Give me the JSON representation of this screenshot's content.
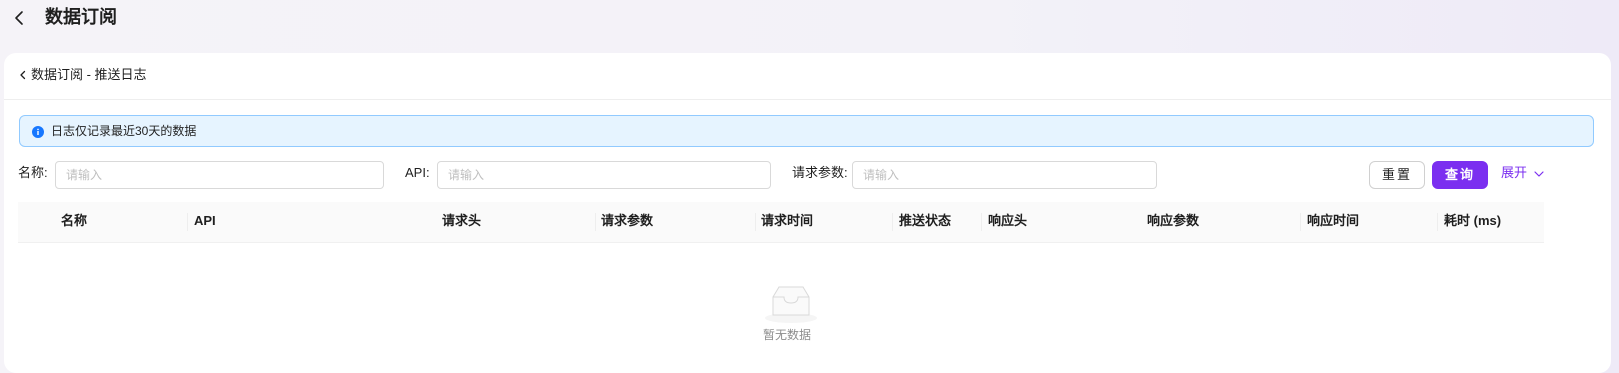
{
  "page": {
    "title": "数据订阅"
  },
  "breadcrumb": {
    "label": "数据订阅 - 推送日志"
  },
  "alert": {
    "message": "日志仅记录最近30天的数据"
  },
  "filters": [
    {
      "label": "名称:",
      "placeholder": "请输入",
      "value": ""
    },
    {
      "label": "API:",
      "placeholder": "请输入",
      "value": ""
    },
    {
      "label": "请求参数:",
      "placeholder": "请输入",
      "value": ""
    }
  ],
  "actions": {
    "reset_label": "重置",
    "query_label": "查询",
    "expand_label": "展开"
  },
  "table": {
    "columns": [
      "名称",
      "API",
      "请求头",
      "请求参数",
      "请求时间",
      "推送状态",
      "响应头",
      "响应参数",
      "响应时间",
      "耗时 (ms)"
    ],
    "rows": [],
    "empty_text": "暂无数据"
  },
  "colors": {
    "accent": "#7b2ff0",
    "alert_background": "#e6f4ff",
    "alert_border": "#91caff",
    "info_icon": "#1677ff"
  }
}
